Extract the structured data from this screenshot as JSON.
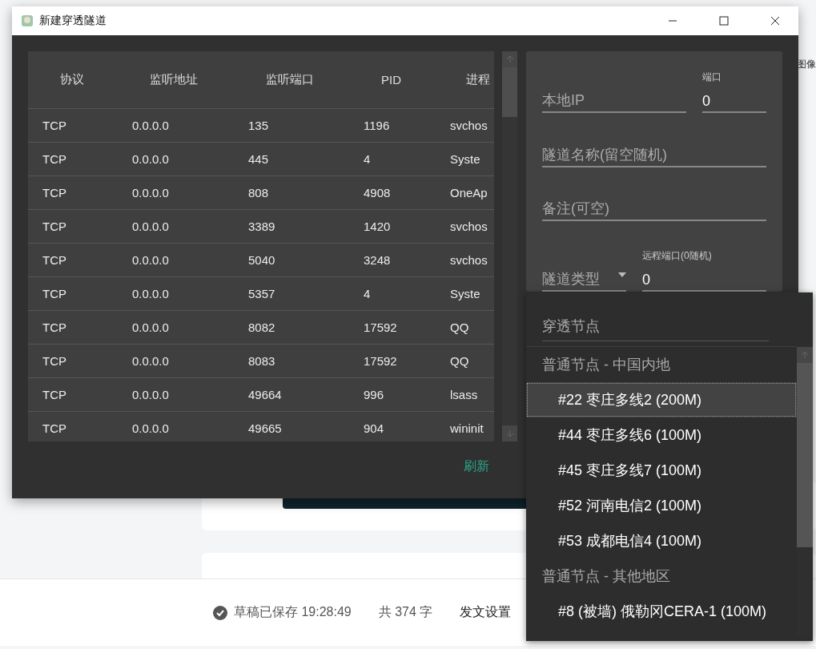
{
  "background_page": {
    "side_label": "图像",
    "status": {
      "saved": "草稿已保存 19:28:49",
      "count": "共 374 字",
      "settings": "发文设置"
    }
  },
  "window": {
    "title": "新建穿透隧道"
  },
  "table": {
    "columns": [
      "协议",
      "监听地址",
      "监听端口",
      "PID",
      "进程"
    ],
    "rows": [
      [
        "TCP",
        "0.0.0.0",
        "135",
        "1196",
        "svchos"
      ],
      [
        "TCP",
        "0.0.0.0",
        "445",
        "4",
        "Syste"
      ],
      [
        "TCP",
        "0.0.0.0",
        "808",
        "4908",
        "OneAp"
      ],
      [
        "TCP",
        "0.0.0.0",
        "3389",
        "1420",
        "svchos"
      ],
      [
        "TCP",
        "0.0.0.0",
        "5040",
        "3248",
        "svchos"
      ],
      [
        "TCP",
        "0.0.0.0",
        "5357",
        "4",
        "Syste"
      ],
      [
        "TCP",
        "0.0.0.0",
        "8082",
        "17592",
        "QQ"
      ],
      [
        "TCP",
        "0.0.0.0",
        "8083",
        "17592",
        "QQ"
      ],
      [
        "TCP",
        "0.0.0.0",
        "49664",
        "996",
        "lsass"
      ],
      [
        "TCP",
        "0.0.0.0",
        "49665",
        "904",
        "wininit"
      ]
    ]
  },
  "refresh_button": "刷新",
  "form": {
    "local_ip": {
      "placeholder": "本地IP"
    },
    "port": {
      "label": "端口",
      "value": "0"
    },
    "tunnel_name": {
      "placeholder": "隧道名称(留空随机)"
    },
    "note": {
      "placeholder": "备注(可空)"
    },
    "tunnel_type": {
      "placeholder": "隧道类型"
    },
    "remote_port": {
      "label": "远程端口(0随机)",
      "value": "0"
    }
  },
  "node_dropdown": {
    "placeholder": "穿透节点",
    "items": [
      {
        "kind": "group",
        "text": "普通节点 - 中国内地"
      },
      {
        "kind": "option",
        "text": "#22 枣庄多线2 (200M)",
        "selected": true
      },
      {
        "kind": "option",
        "text": "#44 枣庄多线6 (100M)",
        "selected": false
      },
      {
        "kind": "option",
        "text": "#45 枣庄多线7 (100M)",
        "selected": false
      },
      {
        "kind": "option",
        "text": "#52 河南电信2 (100M)",
        "selected": false
      },
      {
        "kind": "option",
        "text": "#53 成都电信4 (100M)",
        "selected": false
      },
      {
        "kind": "group",
        "text": "普通节点 - 其他地区"
      },
      {
        "kind": "option",
        "text": "#8 (被墙) 俄勒冈CERA-1 (100M)",
        "selected": false
      }
    ]
  }
}
